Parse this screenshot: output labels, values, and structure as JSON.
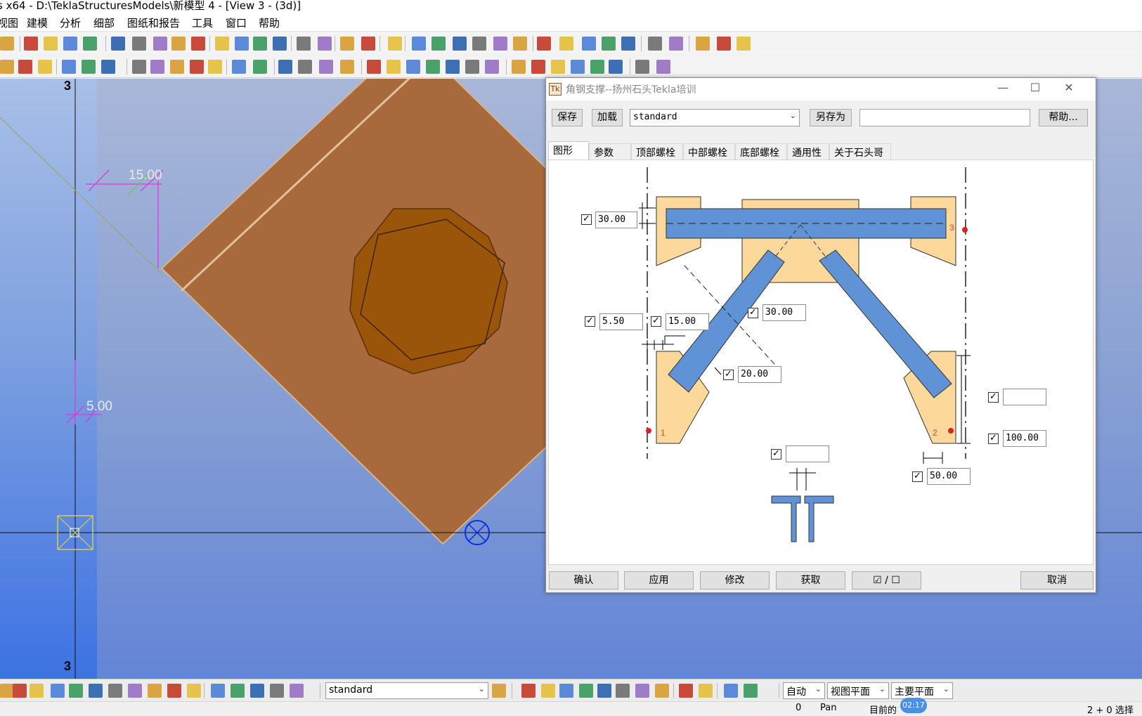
{
  "window": {
    "title": "s x64 - D:\\TeklaStructuresModels\\新模型 4  - [View 3 - (3d)]"
  },
  "menu": [
    "视图",
    "建模",
    "分析",
    "细部",
    "图纸和报告",
    "工具",
    "窗口",
    "帮助"
  ],
  "viewport": {
    "grid_label_top": "3",
    "grid_label_bottom": "3",
    "dim_label_a": "15.00",
    "dim_label_b": "5.00"
  },
  "bottom_toolbar": {
    "filter_value": "standard",
    "select_auto": "自动",
    "select_view_plane": "视图平面",
    "select_main_plane": "主要平面"
  },
  "status_bar": {
    "value_a": "0",
    "mode": "Pan",
    "current": "目前的",
    "time": "02:17",
    "selection": "2 + 0 选择"
  },
  "dialog": {
    "title": "角钢支撑--扬州石头Tekla培训",
    "save_label": "保存",
    "load_label": "加载",
    "preset_value": "standard",
    "save_as_label": "另存为",
    "save_as_value": "",
    "help_label": "帮助...",
    "tabs": [
      "图形",
      "参数",
      "顶部螺栓",
      "中部螺栓",
      "底部螺栓",
      "通用性",
      "关于石头哥"
    ],
    "fields": {
      "top_offset": "30.00",
      "left_a": "5.50",
      "left_b": "15.00",
      "center_gap": "30.00",
      "lower_left": "20.00",
      "right_upper": "",
      "right_lower": "100.00",
      "bottom_center": "",
      "bottom_right": "50.00"
    },
    "point_labels": [
      "1",
      "2",
      "3"
    ],
    "footer": {
      "ok_label": "确认",
      "apply_label": "应用",
      "modify_label": "修改",
      "get_label": "获取",
      "toggle_label": "☑ / ☐",
      "cancel_label": "取消"
    }
  }
}
